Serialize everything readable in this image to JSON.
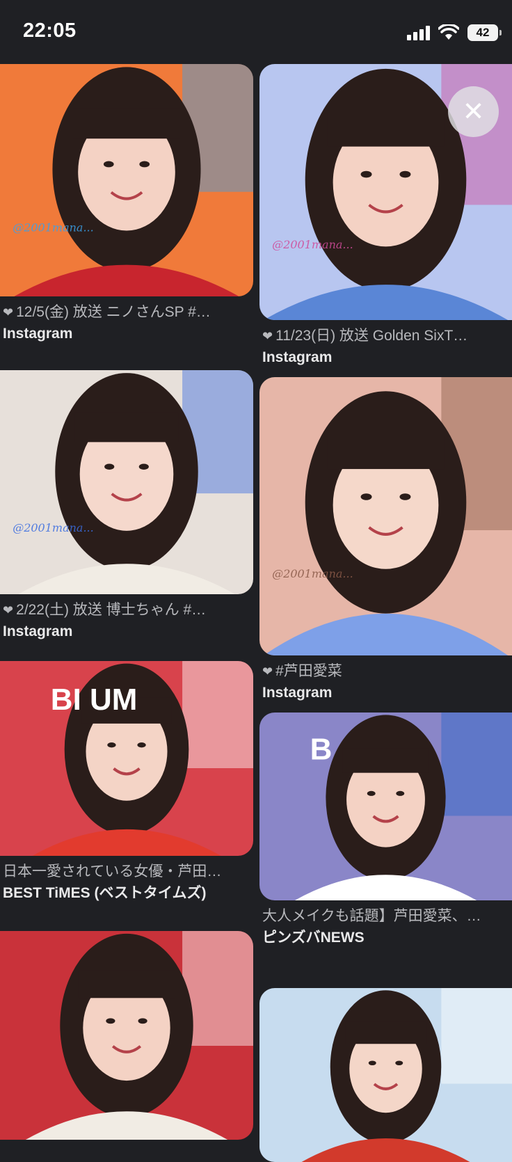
{
  "status_bar": {
    "time": "22:05",
    "battery": "42"
  },
  "left_column": [
    {
      "caption": "12/5(金) 放送 ニノさんSP #…",
      "source": "Instagram",
      "liked": true,
      "bg": "#f07a3a",
      "shirt": "#c8252e",
      "skin": "#f4d2c4",
      "accent": "#3aa0e8",
      "watermark": "@2001mana..."
    },
    {
      "caption": "2/22(土) 放送 博士ちゃん #…",
      "source": "Instagram",
      "liked": true,
      "bg": "#e7e0da",
      "shirt": "#f1ece4",
      "skin": "#f5d8cc",
      "accent": "#3b6de0",
      "watermark": "@2001mana..."
    },
    {
      "caption": "日本一愛されている女優・芦田…",
      "source": "BEST TiMES (ベストタイムズ)",
      "liked": false,
      "bg": "#d8434c",
      "shirt": "#e23b2e",
      "skin": "#f4d4c6",
      "accent": "#ffffff",
      "logo_text": "BI    UM"
    },
    {
      "caption": "",
      "source": "",
      "liked": false,
      "bg": "#c9323a",
      "shirt": "#f1ece4",
      "skin": "#f4d2c4",
      "accent": "#ffffff"
    }
  ],
  "right_column": [
    {
      "caption": "11/23(日) 放送 Golden SixT…",
      "source": "Instagram",
      "liked": true,
      "bg": "#b8c6f0",
      "shirt": "#5a86d6",
      "skin": "#f4d2c4",
      "accent": "#d04b9a",
      "watermark": "@2001mana..."
    },
    {
      "caption": "#芦田愛菜",
      "source": "Instagram",
      "liked": true,
      "bg": "#e6b6a8",
      "shirt": "#7ea0e8",
      "skin": "#f5d8ca",
      "accent": "#8a5a48",
      "watermark": "@2001mana..."
    },
    {
      "caption": "大人メイクも話題】芦田愛菜、…",
      "source": "ピンズバNEWS",
      "liked": false,
      "bg": "#8a86c8",
      "shirt": "#ffffff",
      "skin": "#f4d2c4",
      "accent": "#2b67c8",
      "logo_text": "B"
    },
    {
      "caption": "",
      "source": "",
      "liked": false,
      "bg": "#c7dcef",
      "shirt": "#d23a2c",
      "skin": "#f4d6c8",
      "accent": "#ffffff"
    }
  ],
  "close_button": {
    "glyph": "✕"
  },
  "theme": {
    "background": "#1f2024",
    "caption_color": "#b8b9bd",
    "source_color": "#e9e9ea"
  }
}
